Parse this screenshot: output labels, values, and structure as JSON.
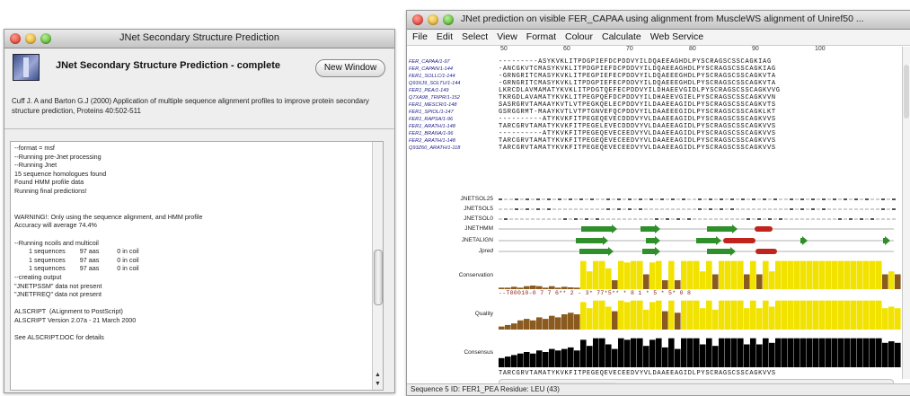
{
  "left_window": {
    "title": "JNet Secondary Structure Prediction",
    "heading": "JNet Secondary Structure Prediction - complete",
    "new_window_label": "New Window",
    "citation": "Cuff J. A and Barton G.J (2000) Application of multiple sequence alignment profiles to improve protein secondary structure prediction, Proteins 40:502-511",
    "log_lines": [
      "--format = msf",
      "--Running pre-Jnet processing",
      "--Running Jnet",
      "15 sequence homologues found",
      "Found HMM profile data",
      "Running final predictions!",
      "",
      "",
      "WARNING!: Only using the sequence alignment, and HMM profile",
      "Accuracy will average 74.4%",
      "",
      "--Running ncoils and multicoil",
      "        1 sequences        97 aas          0 in coil",
      "        1 sequences        97 aas          0 in coil",
      "        1 sequences        97 aas          0 in coil",
      "--creating output",
      "\"JNETPSSM\" data not present",
      "\"JNETFREQ\" data not present",
      "",
      "ALSCRIPT  (ALignment to PostScript)",
      "ALSCRIPT Version 2.07a - 21 March 2000",
      "",
      "See ALSCRIPT.DOC for details"
    ]
  },
  "right_window": {
    "title": "JNet prediction on visible FER_CAPAA using alignment from MuscleWS alignment of Uniref50 ...",
    "menu": [
      "File",
      "Edit",
      "Select",
      "View",
      "Format",
      "Colour",
      "Calculate",
      "Web Service"
    ],
    "ruler_labels": [
      "50",
      "60",
      "70",
      "80",
      "90",
      "100"
    ],
    "sequences": [
      {
        "id": "FER_CAPAA/1-97",
        "residues": "---------ASYKVKLITPDGPIEFDCPDDVYILDQAEEAGHDLPYSCRAGSCSSCAGKIAG"
      },
      {
        "id": "FER_CAPAN/1-144",
        "residues": "-ANCGKVTCMASYKVKLITPDGPIEFDCPDDVYILDQAEEAGHDLPYSCRAGSCSSCAGKIAG"
      },
      {
        "id": "FER1_SOLLC/1-144",
        "residues": "-GRNGRITCMASYKVKLITPEGPIEFECPDDVYILDQAEEEGHDLPYSCRAGSCSSCAGKVTA"
      },
      {
        "id": "Q93XJ9_SOLTU/1-144",
        "residues": "-GRNGRITCMASYKVKLITPDGPIEFECPDDVYILDQAEEEGHDLPYSCRAGSCSSCAGKVTA"
      },
      {
        "id": "FER1_PEA/1-149",
        "residues": "LKRCDLAVMAMATYKVKLITPDGTQEFECPDDVYILDHAEEVGIDLPYSCRAGSCSSCAGKVVG"
      },
      {
        "id": "Q7XA98_TRIPR/1-152",
        "residues": "TKRGDLAVAMATYKVKLITPEGPQEFDCPDDVYILDHAEEVGIELPYSCRAGSCSSCAGKVVN"
      },
      {
        "id": "FER1_MESCR/1-148",
        "residues": "SASRGRVTAMAAYKVTLVTPEGKQELECPDDVYILDAAEEAGIDLPYSCRAGSCSSCAGKVTS"
      },
      {
        "id": "FER1_SPIOL/1-147",
        "residues": "GSRGGRMT-MAAYKVTLVTPTGNVEFQCPDDVYILDAAEEEGIDLPYSCRAGSCSSCAGKLKT"
      },
      {
        "id": "FER1_RAPSA/1-96",
        "residues": "----------ATYKVKFITPEGEQEVECDDDVYVLDAAEEAGIDLPYSCRAGSCSSCAGKVVS"
      },
      {
        "id": "FER1_ARATH/1-148",
        "residues": "TARCGRVTAMATYKVKFITPEGELEVECDDDVYVLDAAEEAGIDLPYSCRAGSCSSCAGKVVS"
      },
      {
        "id": "FER1_BRANA/1-96",
        "residues": "----------ATYKVKFITPEGEQEVECEEDVYVLDAAEEAGIDLPYSCRAGSCSSCAGKVVS"
      },
      {
        "id": "FER2_ARATH/1-148",
        "residues": "TARCGRVTAMATYKVKFITPEGEQEVECEEDVYVLDAAEEAGIDLPYSCRAGSCSSCAGKVVS"
      },
      {
        "id": "Q93Z60_ARATH/1-118",
        "residues": "TARCGRVTAMATYKVKFITPEGEQEVECEEDVYVLDAAEEAGIDLPYSCRAGSCSSCAGKVVS"
      }
    ],
    "annotation_labels": [
      "JNETSOL25",
      "JNETSOL5",
      "JNETSOL0",
      "JNETHMM",
      "JNETALIGN",
      "Jpred",
      "Conservation",
      "Quality",
      "Consensus"
    ],
    "conservation_digits": "--T00010-0 7 7 6** 2 - 3* 77*5** * 8 1 * 5 * 5* 0 8",
    "consensus_sequence": "TARCGRVTAMATYKVKFITPEGEQEVECEEDVYVLDAAEEAGIDLPYSCRAGSCSSCAGKVVS",
    "status": "Sequence 5 ID: FER1_PEA  Residue: LEU (43)",
    "colors": {
      "helix": "#c0241c",
      "strand": "#2f8f2a",
      "conservation_high": "#f2e200",
      "conservation_low": "#8a5a1e",
      "consensus": "#000000"
    }
  }
}
